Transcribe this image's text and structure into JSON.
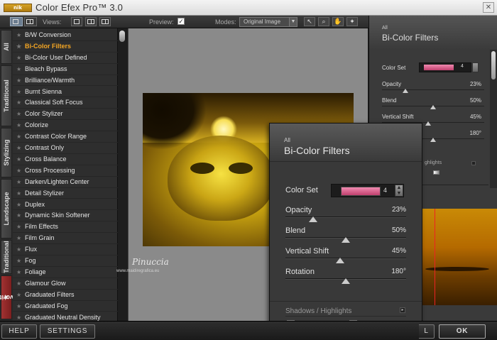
{
  "window": {
    "logo_text": "nik",
    "title": "Color Efex Pro™ 3.0",
    "close_glyph": "✕"
  },
  "toolbar": {
    "views_label": "Views:",
    "preview_label": "Preview:",
    "preview_checked": true,
    "modes_label": "Modes:",
    "modes_value": "Original Image",
    "tools": [
      "arrow-icon",
      "zoom-icon",
      "hand-icon",
      "pin-icon"
    ]
  },
  "side_tabs": [
    "All",
    "Traditional",
    "Stylizing",
    "Landscape",
    "Traditional",
    "Favorites"
  ],
  "filters": [
    "B/W Conversion",
    "Bi-Color Filters",
    "Bi-Color User Defined",
    "Bleach Bypass",
    "Brilliance/Warmth",
    "Burnt Sienna",
    "Classical Soft Focus",
    "Color Stylizer",
    "Colorize",
    "Contrast Color Range",
    "Contrast Only",
    "Cross Balance",
    "Cross Processing",
    "Darken/Lighten Center",
    "Detail Stylizer",
    "Duplex",
    "Dynamic Skin Softener",
    "Film Effects",
    "Film Grain",
    "Flux",
    "Fog",
    "Foliage",
    "Glamour Glow",
    "Graduated Filters",
    "Graduated Fog",
    "Graduated Neutral Density"
  ],
  "active_filter_index": 1,
  "canvas": {
    "watermark": "Pinuccia",
    "watermark_url": "www.maidiregrafica.eu"
  },
  "filter_panel": {
    "category": "All",
    "title": "Bi-Color Filters",
    "color_set_label": "Color Set",
    "color_set_value": "4",
    "sliders": [
      {
        "label": "Opacity",
        "value": "23%",
        "fraction": 0.23
      },
      {
        "label": "Blend",
        "value": "50%",
        "fraction": 0.5
      },
      {
        "label": "Vertical Shift",
        "value": "45%",
        "fraction": 0.45
      },
      {
        "label": "Rotation",
        "value": "180°",
        "fraction": 0.5
      }
    ],
    "shadows_label": "Shadows / Highlights",
    "highlights_partial": "ghlights"
  },
  "bottom": {
    "help_label": "HELP",
    "settings_label": "SETTINGS",
    "cancel_partial": "L",
    "ok_label": "OK"
  },
  "colors": {
    "accent_active": "#f5a623",
    "favorites_tab": "#a23232",
    "color_set_swatch": "#d45a88"
  }
}
